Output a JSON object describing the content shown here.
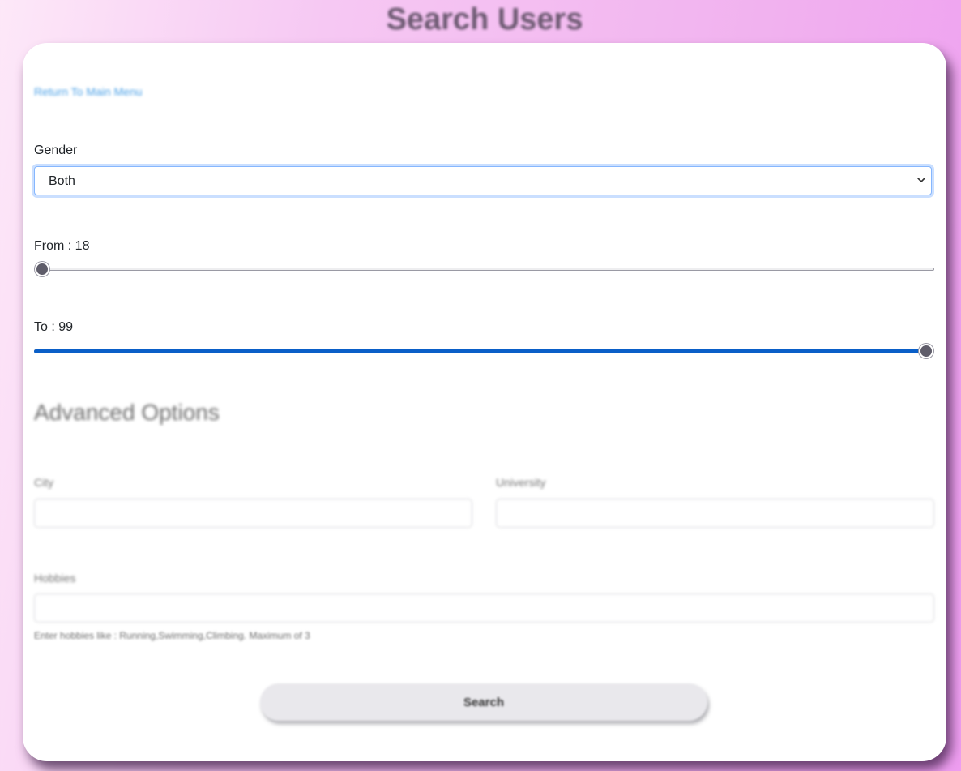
{
  "page": {
    "title": "Search Users"
  },
  "nav": {
    "back_link": "Return To Main Menu"
  },
  "gender": {
    "label": "Gender",
    "selected": "Both"
  },
  "age_from": {
    "label": "From : 18",
    "value": 18,
    "min": 18,
    "max": 99
  },
  "age_to": {
    "label": "To : 99",
    "value": 99,
    "min": 18,
    "max": 99
  },
  "advanced": {
    "heading": "Advanced Options",
    "city_label": "City",
    "city_value": "",
    "university_label": "University",
    "university_value": "",
    "hobbies_label": "Hobbies",
    "hobbies_value": "",
    "hobbies_hint": "Enter hobbies like : Running,Swimming,Climbing. Maximum of 3"
  },
  "actions": {
    "search_label": "Search"
  },
  "colors": {
    "accent": "#0a5fc8",
    "link": "#4aa0e6",
    "background_start": "#fde8f8",
    "background_end": "#ee9df0"
  }
}
